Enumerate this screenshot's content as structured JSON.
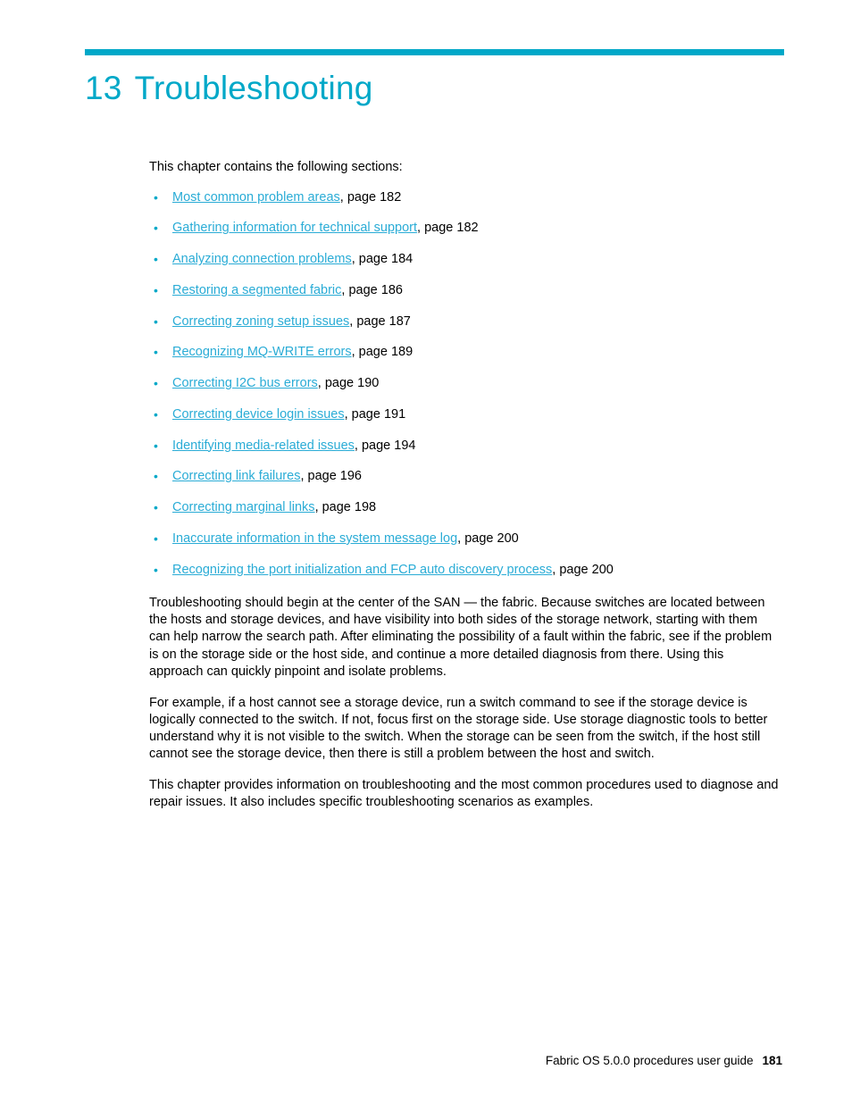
{
  "document": {
    "chapter_number": "13",
    "chapter_title": "Troubleshooting",
    "intro_line": "This chapter contains the following sections:",
    "accent_color": "#00a8c8",
    "link_color": "#2aacd6"
  },
  "toc": [
    {
      "link": "Most common problem areas",
      "tail": ", page 182"
    },
    {
      "link": "Gathering information for technical support",
      "tail": ", page 182"
    },
    {
      "link": "Analyzing connection problems",
      "tail": ", page 184"
    },
    {
      "link": "Restoring a segmented fabric",
      "tail": ", page 186"
    },
    {
      "link": "Correcting zoning setup issues",
      "tail": ", page 187"
    },
    {
      "link": "Recognizing MQ-WRITE errors",
      "tail": ", page 189"
    },
    {
      "link": "Correcting I2C bus errors",
      "tail": ", page 190"
    },
    {
      "link": "Correcting device login issues",
      "tail": ", page 191"
    },
    {
      "link": "Identifying media-related issues",
      "tail": ", page 194"
    },
    {
      "link": "Correcting link failures",
      "tail": ", page 196"
    },
    {
      "link": "Correcting marginal links",
      "tail": ", page 198"
    },
    {
      "link": "Inaccurate information in the system message log",
      "tail": ", page 200"
    },
    {
      "link": "Recognizing the port initialization and FCP auto discovery process",
      "tail": ", page 200"
    }
  ],
  "paragraphs": [
    "Troubleshooting should begin at the center of the SAN — the fabric. Because switches are located between the hosts and storage devices, and have visibility into both sides of the storage network, starting with them can help narrow the search path. After eliminating the possibility of a fault within the fabric, see if the problem is on the storage side or the host side, and continue a more detailed diagnosis from there. Using this approach can quickly pinpoint and isolate problems.",
    "For example, if a host cannot see a storage device, run a switch command to see if the storage device is logically connected to the switch. If not, focus first on the storage side. Use storage diagnostic tools to better understand why it is not visible to the switch. When the storage can be seen from the switch, if the host still cannot see the storage device, then there is still a problem between the host and switch.",
    "This chapter provides information on troubleshooting and the most common procedures used to diagnose and repair issues. It also includes specific troubleshooting scenarios as examples."
  ],
  "footer": {
    "text": "Fabric OS 5.0.0 procedures user guide",
    "page_number": "181"
  }
}
